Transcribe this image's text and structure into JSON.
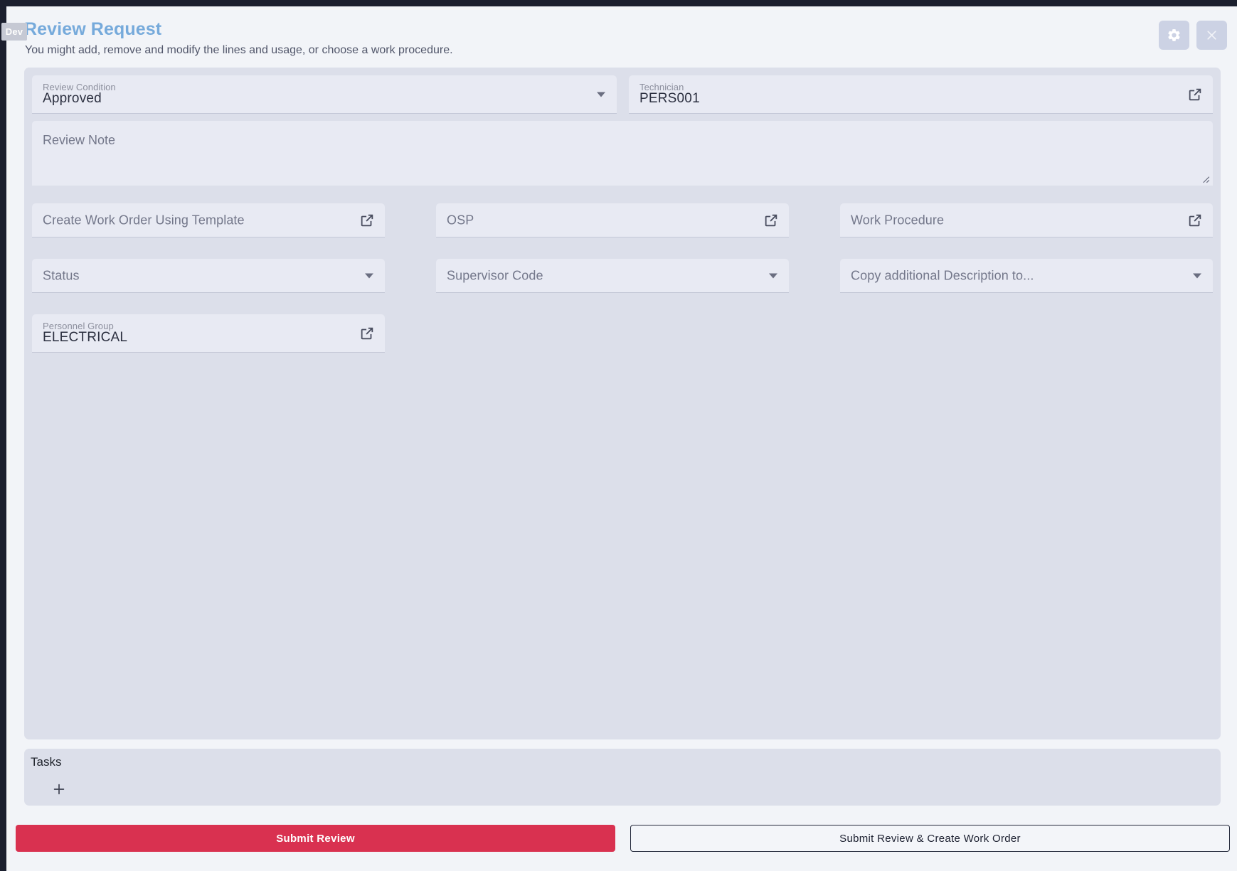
{
  "window": {
    "dev_badge": "Dev"
  },
  "header": {
    "title": "Review Request",
    "subtitle": "You might add, remove and modify the lines and usage, or choose a work procedure.",
    "settings_icon": "gear-icon",
    "close_icon": "close-icon"
  },
  "form": {
    "review_condition": {
      "label": "Review Condition",
      "value": "Approved",
      "control": "select"
    },
    "technician": {
      "label": "Technician",
      "value": "PERS001",
      "control": "lookup",
      "icon": "external-link-icon"
    },
    "review_note": {
      "placeholder": "Review Note",
      "value": "",
      "control": "textarea"
    },
    "create_work_order_template": {
      "placeholder": "Create Work Order Using Template",
      "value": "",
      "control": "lookup",
      "icon": "external-link-icon"
    },
    "osp": {
      "placeholder": "OSP",
      "value": "",
      "control": "lookup",
      "icon": "external-link-icon"
    },
    "work_procedure": {
      "placeholder": "Work Procedure",
      "value": "",
      "control": "lookup",
      "icon": "external-link-icon"
    },
    "status": {
      "placeholder": "Status",
      "value": "",
      "control": "select"
    },
    "supervisor_code": {
      "placeholder": "Supervisor Code",
      "value": "",
      "control": "select"
    },
    "copy_additional_description": {
      "placeholder": "Copy additional Description to...",
      "value": "",
      "control": "select"
    },
    "personnel_group": {
      "label": "Personnel Group",
      "value": "ELECTRICAL",
      "control": "lookup",
      "icon": "external-link-icon"
    }
  },
  "tasks": {
    "title": "Tasks",
    "add_icon": "plus-icon",
    "items": []
  },
  "footer": {
    "submit_review_label": "Submit Review",
    "submit_create_wo_label": "Submit Review & Create Work Order"
  },
  "colors": {
    "accent_title": "#76aadb",
    "primary_action": "#d93150",
    "panel": "#dcdfea",
    "field": "#e8eaf3",
    "dialog": "#f2f4f8"
  }
}
